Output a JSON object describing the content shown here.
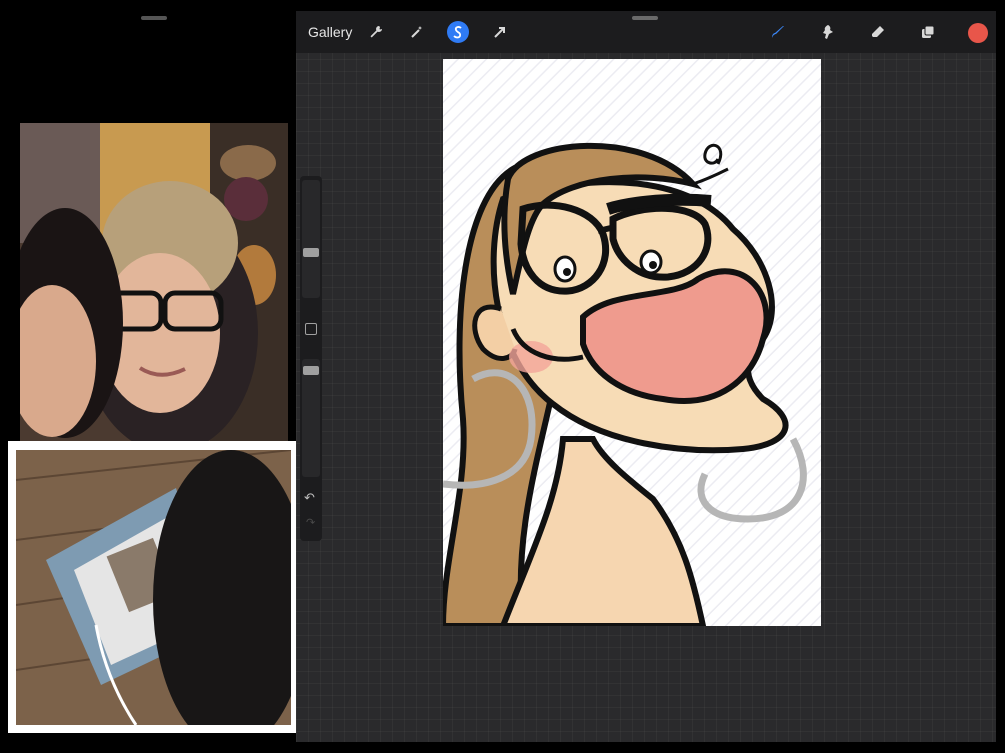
{
  "toolbar": {
    "gallery_label": "Gallery",
    "left_tools": [
      {
        "icon": "wrench-icon"
      },
      {
        "icon": "magic-wand-icon"
      },
      {
        "icon": "selection-icon",
        "active": true
      },
      {
        "icon": "transform-arrow-icon"
      }
    ],
    "right_tools": [
      {
        "icon": "brush-icon",
        "active": true
      },
      {
        "icon": "smudge-icon"
      },
      {
        "icon": "eraser-icon"
      },
      {
        "icon": "layers-icon"
      }
    ],
    "current_color": "#e8564a"
  },
  "sidebar": {
    "brush_size_icon": "brush-size-slider",
    "modify_icon": "square-icon",
    "opacity_icon": "opacity-slider",
    "undo_icon": "undo-icon",
    "redo_icon": "redo-icon"
  },
  "colors": {
    "accent_blue": "#2f7bf5",
    "background": "#2a2a2c",
    "toolbar": "#1c1c1e"
  }
}
